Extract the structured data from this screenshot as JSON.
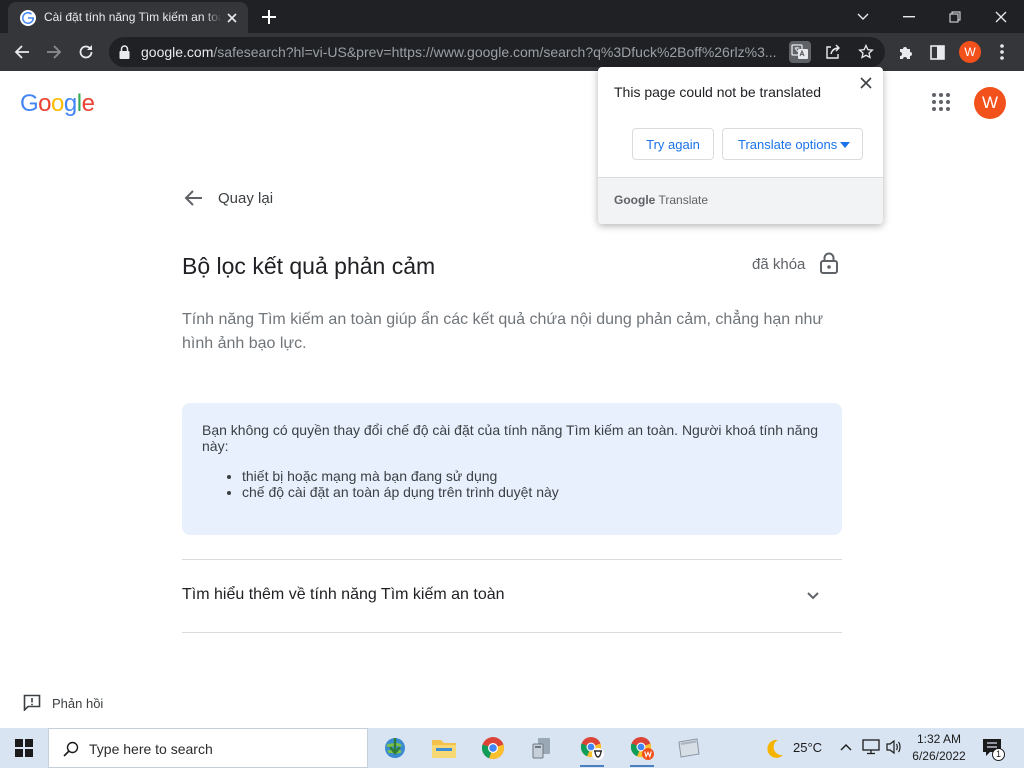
{
  "browser": {
    "tab_title": "Cài đặt tính năng Tìm kiếm an toàn",
    "url_host": "google.com",
    "url_rest": "/safesearch?hl=vi-US&prev=https://www.google.com/search?q%3Dfuck%2Boff%26rlz%3...",
    "profile_initial": "W"
  },
  "header": {
    "logo_letters": [
      "G",
      "o",
      "o",
      "g",
      "l",
      "e"
    ],
    "logo_colors": [
      "#4285f4",
      "#ea4335",
      "#fbbc05",
      "#4285f4",
      "#34a853",
      "#ea4335"
    ],
    "avatar_initial": "W"
  },
  "main": {
    "back_label": "Quay lại",
    "title": "Bộ lọc kết quả phản cảm",
    "locked_label": "đã khóa",
    "description": "Tính năng Tìm kiếm an toàn giúp ẩn các kết quả chứa nội dung phản cảm, chẳng hạn như hình ảnh bạo lực.",
    "notice": {
      "text": "Bạn không có quyền thay đổi chế độ cài đặt của tính năng Tìm kiếm an toàn. Người khoá tính năng này:",
      "items": [
        "thiết bị hoặc mạng mà bạn đang sử dụng",
        "chế độ cài đặt an toàn áp dụng trên trình duyệt này"
      ]
    },
    "learn_more": "Tìm hiểu thêm về tính năng Tìm kiếm an toàn",
    "feedback_label": "Phản hồi"
  },
  "translate_popup": {
    "message": "This page could not be translated",
    "try_again": "Try again",
    "options": "Translate options",
    "brand_google": "Google",
    "brand_translate": "Translate"
  },
  "taskbar": {
    "search_placeholder": "Type here to search",
    "weather": "25°C",
    "time": "1:32 AM",
    "date": "6/26/2022",
    "notification_count": "1"
  },
  "colors": {
    "accent_blue": "#1a73e8",
    "avatar_orange": "#f2511b",
    "notice_bg": "#e8f0fe"
  }
}
